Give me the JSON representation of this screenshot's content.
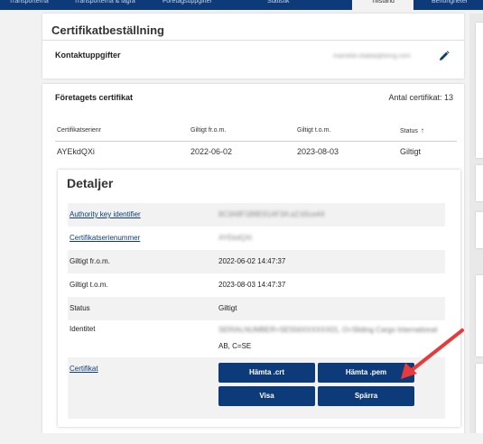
{
  "nav": {
    "tabs": [
      "Transporterna",
      "Transporterna & lagra",
      "Företagsuppgifter",
      "Statistik",
      "Tillstånd",
      "Behörigheter"
    ],
    "active_index": 4
  },
  "order_card": {
    "title": "Certifikatbeställning",
    "contact_label": "Kontaktuppgifter",
    "email": "mamiklin.blabla@tiring.com"
  },
  "cert_card": {
    "title": "Företagets certifikat",
    "count_text": "Antal certifikat: 13",
    "columns": [
      "Certifikatserienr",
      "Giltigt fr.o.m.",
      "Giltigt t.o.m.",
      "Status"
    ],
    "row": {
      "serial": "AYEkdQXi",
      "from": "2022-06-02",
      "to": "2023-08-03",
      "status": "Giltigt"
    }
  },
  "details": {
    "title": "Detaljer",
    "rows": [
      {
        "label": "Authority key identifier",
        "value": "8C3A8F1B8E91AF3A:a2:b5ce44"
      },
      {
        "label": "Certifikatserienummer",
        "value": "AYEkdQXi"
      },
      {
        "label": "Giltigt fr.o.m.",
        "value": "2022-06-02 14:47:37"
      },
      {
        "label": "Giltigt t.o.m.",
        "value": "2023-08-03 14:47:37"
      },
      {
        "label": "Status",
        "value": "Giltigt"
      },
      {
        "label": "Identitet",
        "value_line1": "SERIALNUMBER=SE556XXXXXX01, O=Sliding Cargo International",
        "value_line2": "AB, C=SE"
      },
      {
        "label": "Certifikat"
      }
    ],
    "buttons": {
      "download_crt": "Hämta .crt",
      "download_pem": "Hämta .pem",
      "show": "Visa",
      "block": "Spärra"
    }
  },
  "colors": {
    "primary": "#0d3b7a",
    "arrow": "#e83a3a"
  }
}
